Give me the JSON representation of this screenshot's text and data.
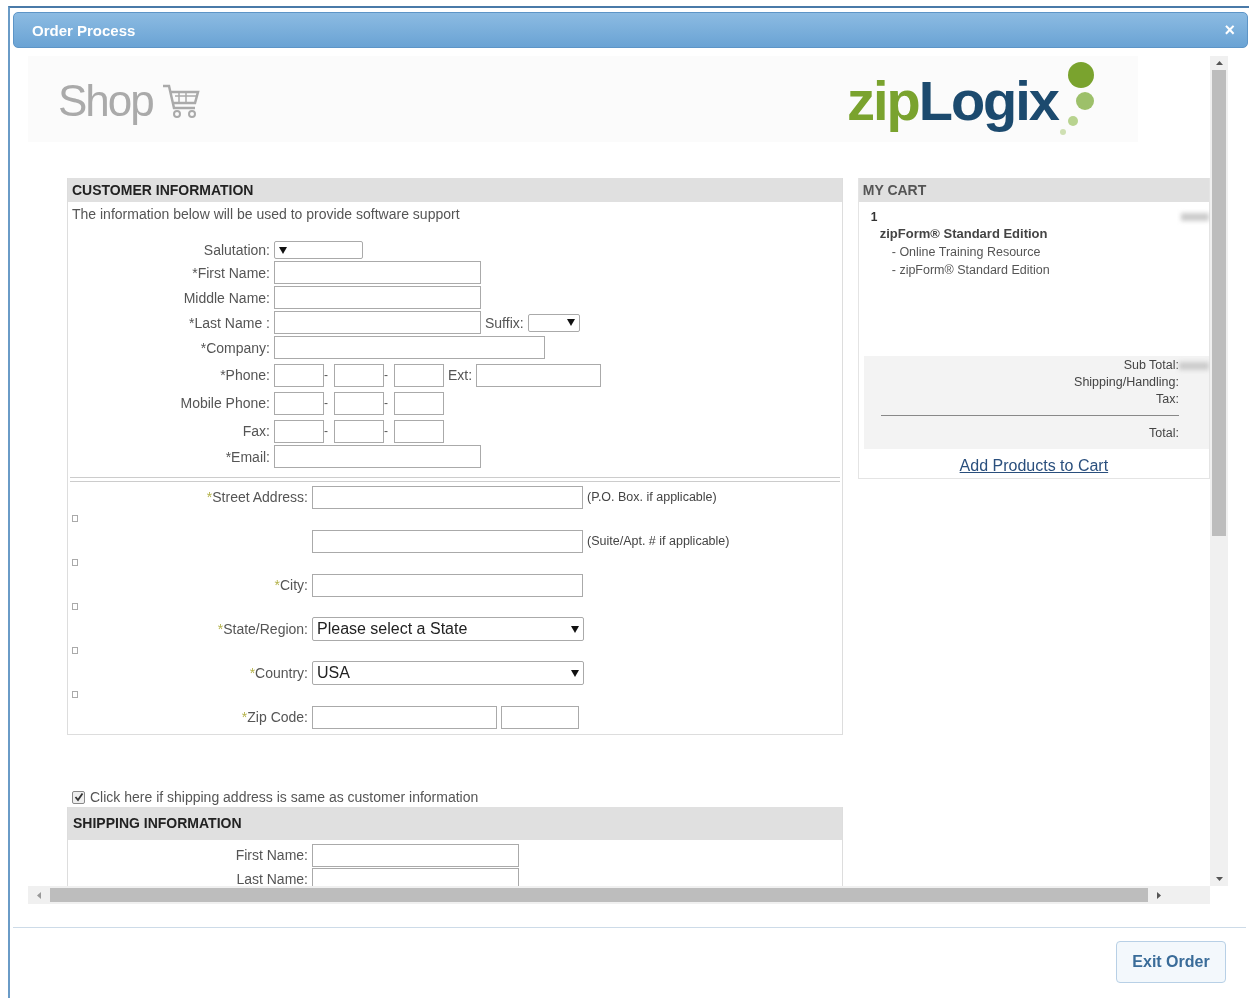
{
  "window": {
    "title": "Order Process",
    "close": "×"
  },
  "banner": {
    "shop": "Shop",
    "brand": {
      "part_1": "zip",
      "part_2": "Logix"
    }
  },
  "customer_information": {
    "title": "CUSTOMER INFORMATION",
    "note": "The information below will be used to provide software support",
    "fields": [
      {
        "kind": "select",
        "label": "Salutation:"
      },
      {
        "kind": "text",
        "label": "*First Name:"
      },
      {
        "kind": "text",
        "label": "Middle Name:"
      },
      {
        "kind": "suffix",
        "label": "*Last Name :",
        "suffix_label": "Suffix:"
      },
      {
        "kind": "wide",
        "label": "*Company:"
      },
      {
        "kind": "phone",
        "label": "*Phone:",
        "separator": "-",
        "ext_label": "Ext:"
      },
      {
        "kind": "phone",
        "label": "Mobile Phone:",
        "separator": "-"
      },
      {
        "kind": "phone",
        "label": "Fax:",
        "separator": "-"
      },
      {
        "kind": "text",
        "label": "*Email:"
      }
    ],
    "address": [
      {
        "kind": "text",
        "required_mark": "*",
        "label": "Street Address:",
        "hint": "(P.O. Box.  if applicable)"
      },
      {
        "kind": "text",
        "hint": "(Suite/Apt. # if applicable)"
      },
      {
        "kind": "text",
        "required_mark": "*",
        "label": "City:"
      },
      {
        "kind": "select",
        "required_mark": "*",
        "label": "State/Region:",
        "value": "Please select a State"
      },
      {
        "kind": "select",
        "required_mark": "*",
        "label": "Country:",
        "value": "USA"
      },
      {
        "kind": "zip",
        "required_mark": "*",
        "label": "Zip Code:"
      }
    ]
  },
  "same_address": {
    "checked": true,
    "label": "Click here if shipping address is same as customer information"
  },
  "shipping_information": {
    "title": "SHIPPING INFORMATION",
    "fields": [
      {
        "label": "First Name:"
      },
      {
        "label": "Last Name:"
      }
    ]
  },
  "cart": {
    "title": "MY CART",
    "items": [
      {
        "quantity": "1",
        "name": "zipForm® Standard Edition",
        "components": [
          "- Online Training Resource",
          "- zipForm® Standard Edition"
        ]
      }
    ],
    "totals": [
      "Sub Total:",
      "Shipping/Handling:",
      "Tax:"
    ],
    "total": "Total:",
    "link": "Add Products to Cart"
  },
  "buttons": [
    "Exit Order"
  ]
}
